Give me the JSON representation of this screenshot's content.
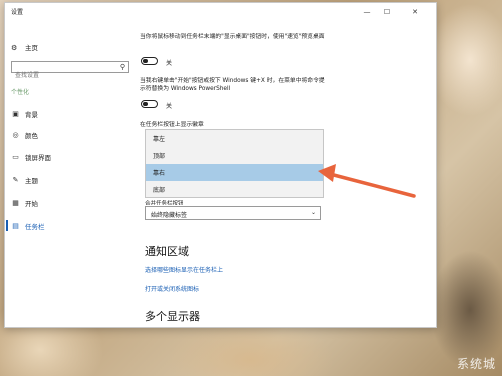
{
  "window": {
    "title": "设置",
    "minimize": "—",
    "maximize": "☐",
    "close": "✕"
  },
  "sidebar": {
    "home": "主页",
    "search_placeholder": "查找设置",
    "section": "个性化",
    "items": [
      {
        "label": "背景"
      },
      {
        "label": "颜色"
      },
      {
        "label": "锁屏界面"
      },
      {
        "label": "主题"
      },
      {
        "label": "开始"
      },
      {
        "label": "任务栏"
      }
    ]
  },
  "main": {
    "peek_desc": "当你将鼠标移动到任务栏末端的\"显示桌面\"按钮时，使用\"速览\"预览桌面",
    "peek_toggle": "关",
    "powershell_desc": "当我右键单击\"开始\"按钮或按下 Windows 键+X 时，在菜单中将命令提示符替换为 Windows PowerShell",
    "powershell_toggle": "关",
    "location_label": "在任务栏按钮上显示徽章",
    "location_options": [
      "靠左",
      "顶部",
      "靠右",
      "底部"
    ],
    "selected_option": "靠右",
    "combine_caption": "合并任务栏按钮",
    "combine_value": "始终隐藏标签",
    "notification_heading": "通知区域",
    "link_icons": "选择哪些图标显示在任务栏上",
    "link_system_icons": "打开或关闭系统图标",
    "multi_display_heading": "多个显示器"
  },
  "watermark": "系统城",
  "colors": {
    "accent": "#1a5fb4",
    "selected_option": "#a7cbe7",
    "arrow": "#e8643c"
  }
}
